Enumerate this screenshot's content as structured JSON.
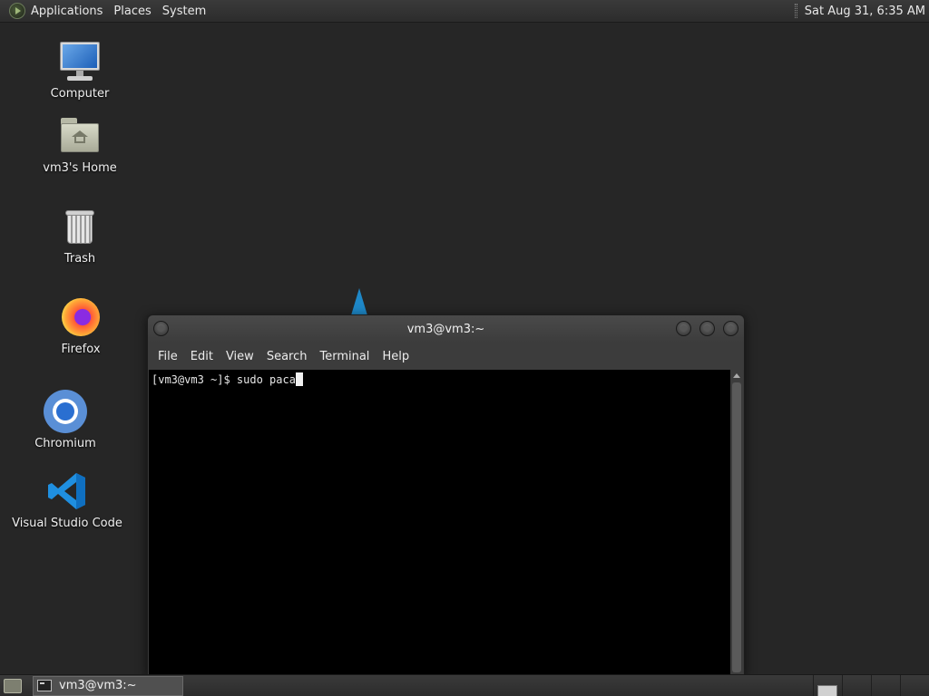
{
  "top_panel": {
    "menus": [
      "Applications",
      "Places",
      "System"
    ],
    "clock": "Sat Aug 31,  6:35 AM"
  },
  "desktop_icons": [
    {
      "label": "Computer",
      "icon": "computer-icon"
    },
    {
      "label": "vm3's Home",
      "icon": "home-folder-icon"
    },
    {
      "label": "Trash",
      "icon": "trash-icon"
    },
    {
      "label": "Firefox",
      "icon": "firefox-icon"
    },
    {
      "label": "Chromium",
      "icon": "chromium-icon"
    },
    {
      "label": "Visual Studio Code",
      "icon": "vscode-icon"
    }
  ],
  "terminal": {
    "title": "vm3@vm3:~",
    "menus": [
      "File",
      "Edit",
      "View",
      "Search",
      "Terminal",
      "Help"
    ],
    "prompt": "[vm3@vm3 ~]$ ",
    "input": "sudo paca"
  },
  "taskbar": {
    "tasks": [
      {
        "label": "vm3@vm3:~",
        "icon": "terminal-icon"
      }
    ],
    "workspace_count": 4,
    "active_workspace": 1
  },
  "colors": {
    "desktop_bg": "#262626",
    "panel_bg": "#333333",
    "terminal_bg": "#000000",
    "wallpaper_accent": "#1e88c8"
  }
}
